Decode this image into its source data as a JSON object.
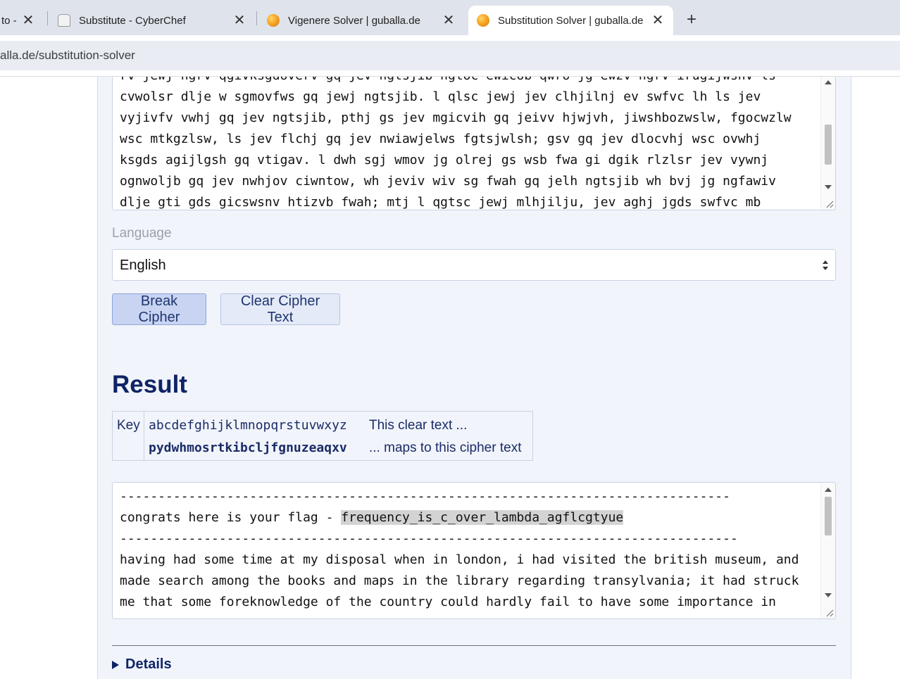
{
  "browser": {
    "tabs": [
      {
        "title": "to -",
        "icon": "partial-tab-icon",
        "active": false
      },
      {
        "title": "Substitute - CyberChef",
        "icon": "chef-hat-icon",
        "active": false
      },
      {
        "title": "Vigenere Solver | guballa.de",
        "icon": "orange-ball-icon",
        "active": false
      },
      {
        "title": "Substitution Solver | guballa.de",
        "icon": "orange-ball-icon",
        "active": true
      }
    ],
    "close_glyph": "✕",
    "new_tab_glyph": "+",
    "url": "alla.de/substitution-solver"
  },
  "cipher_input": {
    "lines": [
      "rv jewj ngrv qgivksgdoverv gq jev ngtsjib ngtoc ewicob qwro jg ewzv ngrv irugijwshv ls",
      "cvwolsr dlje w sgmovfws gq jewj ngtsjib. l qlsc jewj jev clhjilnj ev swfvc lh ls jev",
      "vyjivfv vwhj gq jev ngtsjib, pthj gs jev mgicvih gq jeivv hjwjvh, jiwshbozwslw, fgocwzlw",
      "wsc mtkgzlsw, ls jev flchj gq jev nwiawjelws fgtsjwlsh; gsv gq jev dlocvhj wsc ovwhj",
      "ksgds agijlgsh gq vtigav. l dwh sgj wmov jg olrej gs wsb fwa gi dgik rlzlsr jev vywnj",
      "ognwoljb gq jev nwhjov ciwntow, wh jeviv wiv sg fwah gq jelh ngtsjib wh bvj jg ngfawiv",
      "dlje gti gds gicswsnv htizvb fwah; mtj l qgtsc jewj mlhjilju, jev aghj jgds swfvc mb"
    ]
  },
  "language": {
    "label": "Language",
    "selected": "English"
  },
  "buttons": {
    "break": "Break Cipher",
    "clear": "Clear Cipher Text"
  },
  "result": {
    "heading": "Result",
    "key_label": "Key",
    "plain_alphabet": "abcdefghijklmnopqrstuvwxyz",
    "cipher_alphabet": "pydwhmosrtkibcljfgnuzeaqxv",
    "plain_desc": "This clear text ...",
    "cipher_desc": "... maps to this cipher text"
  },
  "output": {
    "rule1": "--------------------------------------------------------------------------------",
    "flag_prefix": "congrats here is your flag - ",
    "flag_value": "frequency_is_c_over_lambda_agflcgtyue",
    "rule2": "---------------------------------------------------------------------------------",
    "lines": [
      "having had some time at my disposal when in london, i had visited the british museum, and",
      "made search among the books and maps in the library regarding transylvania; it had struck",
      "me that some foreknowledge of the country could hardly fail to have some importance in"
    ]
  },
  "details": {
    "label": "Details"
  }
}
